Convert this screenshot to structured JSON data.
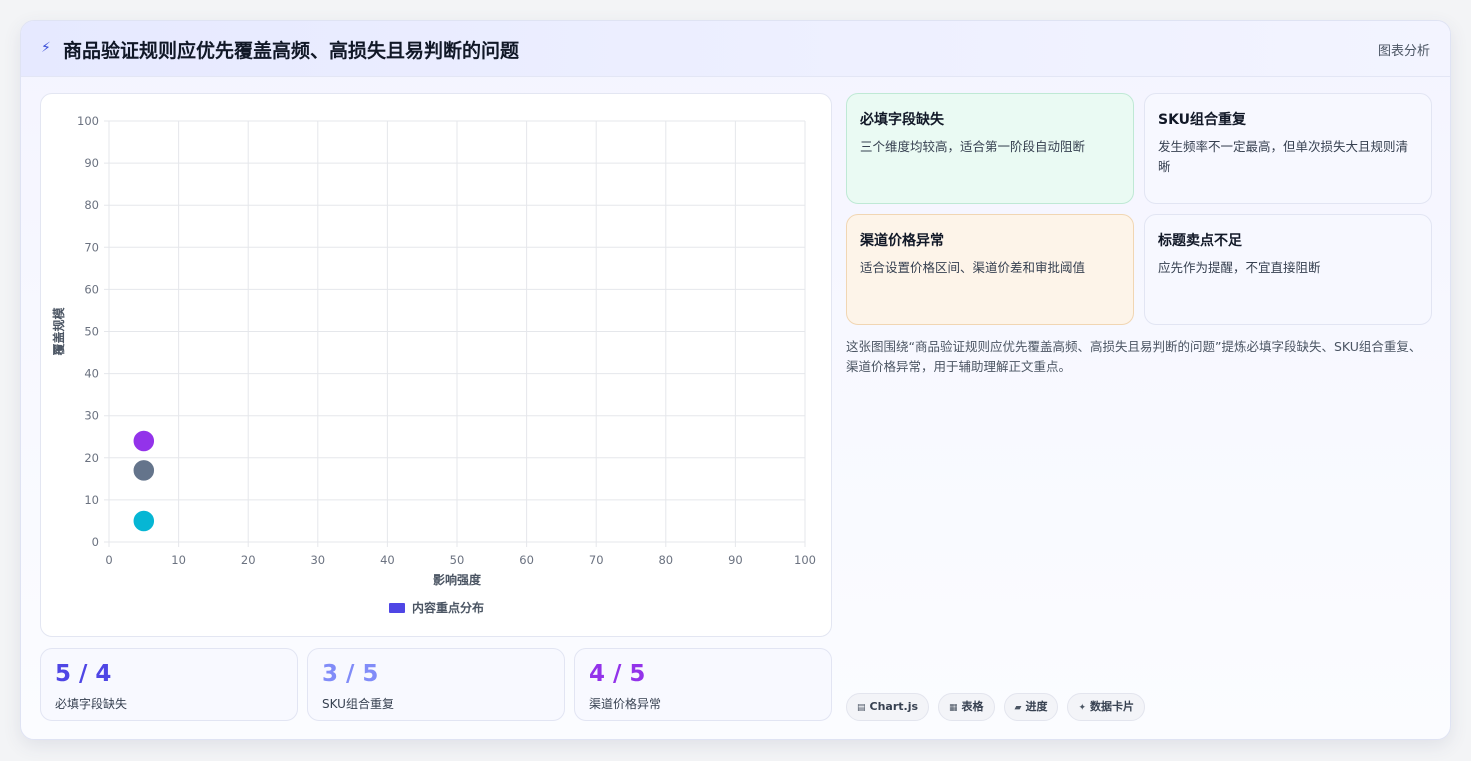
{
  "header": {
    "title": "商品验证规则应优先覆盖高频、高损失且易判断的问题",
    "tag": "图表分析",
    "icon": "bolt-icon"
  },
  "chart_data": {
    "type": "scatter",
    "title": "",
    "xlabel": "影响强度",
    "ylabel": "覆盖规模",
    "xlim": [
      0,
      100
    ],
    "ylim": [
      0,
      100
    ],
    "x_ticks": [
      "0",
      "10",
      "20",
      "30",
      "40",
      "50",
      "60",
      "70",
      "80",
      "90",
      "100"
    ],
    "y_ticks": [
      "0",
      "10",
      "20",
      "30",
      "40",
      "50",
      "60",
      "70",
      "80",
      "90",
      "100"
    ],
    "grid": true,
    "legend": {
      "position": "bottom",
      "label": "内容重点分布",
      "color": "#4f46e5"
    },
    "points": [
      {
        "x": 5,
        "y": 24,
        "color": "#9333ea"
      },
      {
        "x": 5,
        "y": 17,
        "color": "#64748b"
      },
      {
        "x": 5,
        "y": 5,
        "color": "#06b6d4"
      }
    ]
  },
  "stats": [
    {
      "value": "5 / 4",
      "label": "必填字段缺失",
      "color": "#4f46e5"
    },
    {
      "value": "3 / 5",
      "label": "SKU组合重复",
      "color": "#818cf8"
    },
    {
      "value": "4 / 5",
      "label": "渠道价格异常",
      "color": "#9333ea"
    }
  ],
  "cards": [
    {
      "title": "必填字段缺失",
      "desc": "三个维度均较高，适合第一阶段自动阻断"
    },
    {
      "title": "SKU组合重复",
      "desc": "发生频率不一定最高，但单次损失大且规则清晰"
    },
    {
      "title": "渠道价格异常",
      "desc": "适合设置价格区间、渠道价差和审批阈值"
    },
    {
      "title": "标题卖点不足",
      "desc": "应先作为提醒，不宜直接阻断"
    }
  ],
  "summary": "这张图围绕“商品验证规则应优先覆盖高频、高损失且易判断的问题”提炼必填字段缺失、SKU组合重复、渠道价格异常，用于辅助理解正文重点。",
  "chips": [
    {
      "icon": "▤",
      "label": "Chart.js"
    },
    {
      "icon": "▦",
      "label": "表格"
    },
    {
      "icon": "▰",
      "label": "进度"
    },
    {
      "icon": "✦",
      "label": "数据卡片"
    }
  ]
}
